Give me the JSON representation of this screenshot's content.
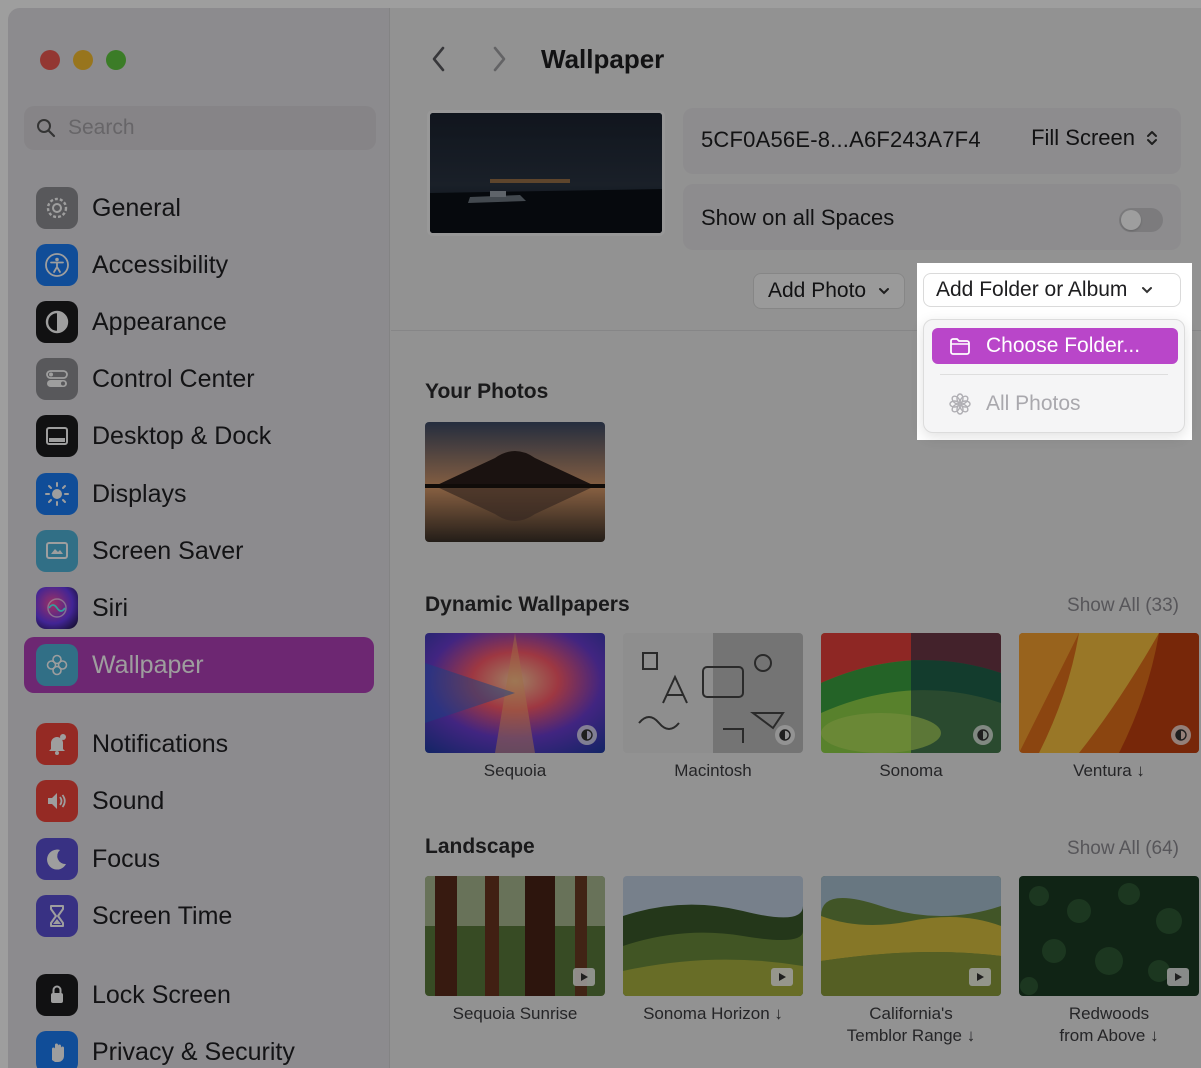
{
  "window": {
    "title": "Wallpaper"
  },
  "sidebar": {
    "search_placeholder": "Search",
    "items": [
      {
        "label": "General",
        "icon": "gear-icon",
        "color": "#8e8e93"
      },
      {
        "label": "Accessibility",
        "icon": "accessibility-icon",
        "color": "#1a7cf5"
      },
      {
        "label": "Appearance",
        "icon": "appearance-icon",
        "color": "#1c1c1e"
      },
      {
        "label": "Control Center",
        "icon": "control-center-icon",
        "color": "#8e8e93"
      },
      {
        "label": "Desktop & Dock",
        "icon": "dock-icon",
        "color": "#1c1c1e"
      },
      {
        "label": "Displays",
        "icon": "sun-icon",
        "color": "#1a7cf5"
      },
      {
        "label": "Screen Saver",
        "icon": "screen-saver-icon",
        "color": "#4fb3d9"
      },
      {
        "label": "Siri",
        "icon": "siri-icon",
        "color": "#3a2a6e"
      },
      {
        "label": "Wallpaper",
        "icon": "wallpaper-flower-icon",
        "color": "#4fb3d9"
      },
      {
        "label": "Notifications",
        "icon": "bell-icon",
        "color": "#f0453a"
      },
      {
        "label": "Sound",
        "icon": "speaker-icon",
        "color": "#f0453a"
      },
      {
        "label": "Focus",
        "icon": "moon-icon",
        "color": "#5b4fd4"
      },
      {
        "label": "Screen Time",
        "icon": "hourglass-icon",
        "color": "#5b4fd4"
      },
      {
        "label": "Lock Screen",
        "icon": "lock-icon",
        "color": "#1c1c1e"
      },
      {
        "label": "Privacy & Security",
        "icon": "hand-icon",
        "color": "#1a7cf5"
      }
    ],
    "active": "Wallpaper"
  },
  "header": {
    "title": "Wallpaper"
  },
  "current": {
    "file_name": "5CF0A56E-8...A6F243A7F4",
    "fill_mode": "Fill Screen",
    "show_on_all_spaces_label": "Show on all Spaces",
    "show_on_all_spaces": false
  },
  "buttons": {
    "add_photo": "Add Photo",
    "add_folder": "Add Folder or Album"
  },
  "menu": {
    "choose_folder": "Choose Folder...",
    "all_photos": "All Photos"
  },
  "sections": {
    "your_photos": {
      "title": "Your Photos"
    },
    "dynamic": {
      "title": "Dynamic Wallpapers",
      "show_all": "Show All (33)",
      "items": [
        "Sequoia",
        "Macintosh",
        "Sonoma",
        "Ventura ↓"
      ]
    },
    "landscape": {
      "title": "Landscape",
      "show_all": "Show All (64)",
      "items": [
        "Sequoia Sunrise",
        "Sonoma Horizon ↓",
        "California's\nTemblor Range ↓",
        "Redwoods\nfrom Above ↓"
      ]
    }
  },
  "colors": {
    "accent": "#b03fb9",
    "menu_highlight": "#b946c9"
  }
}
